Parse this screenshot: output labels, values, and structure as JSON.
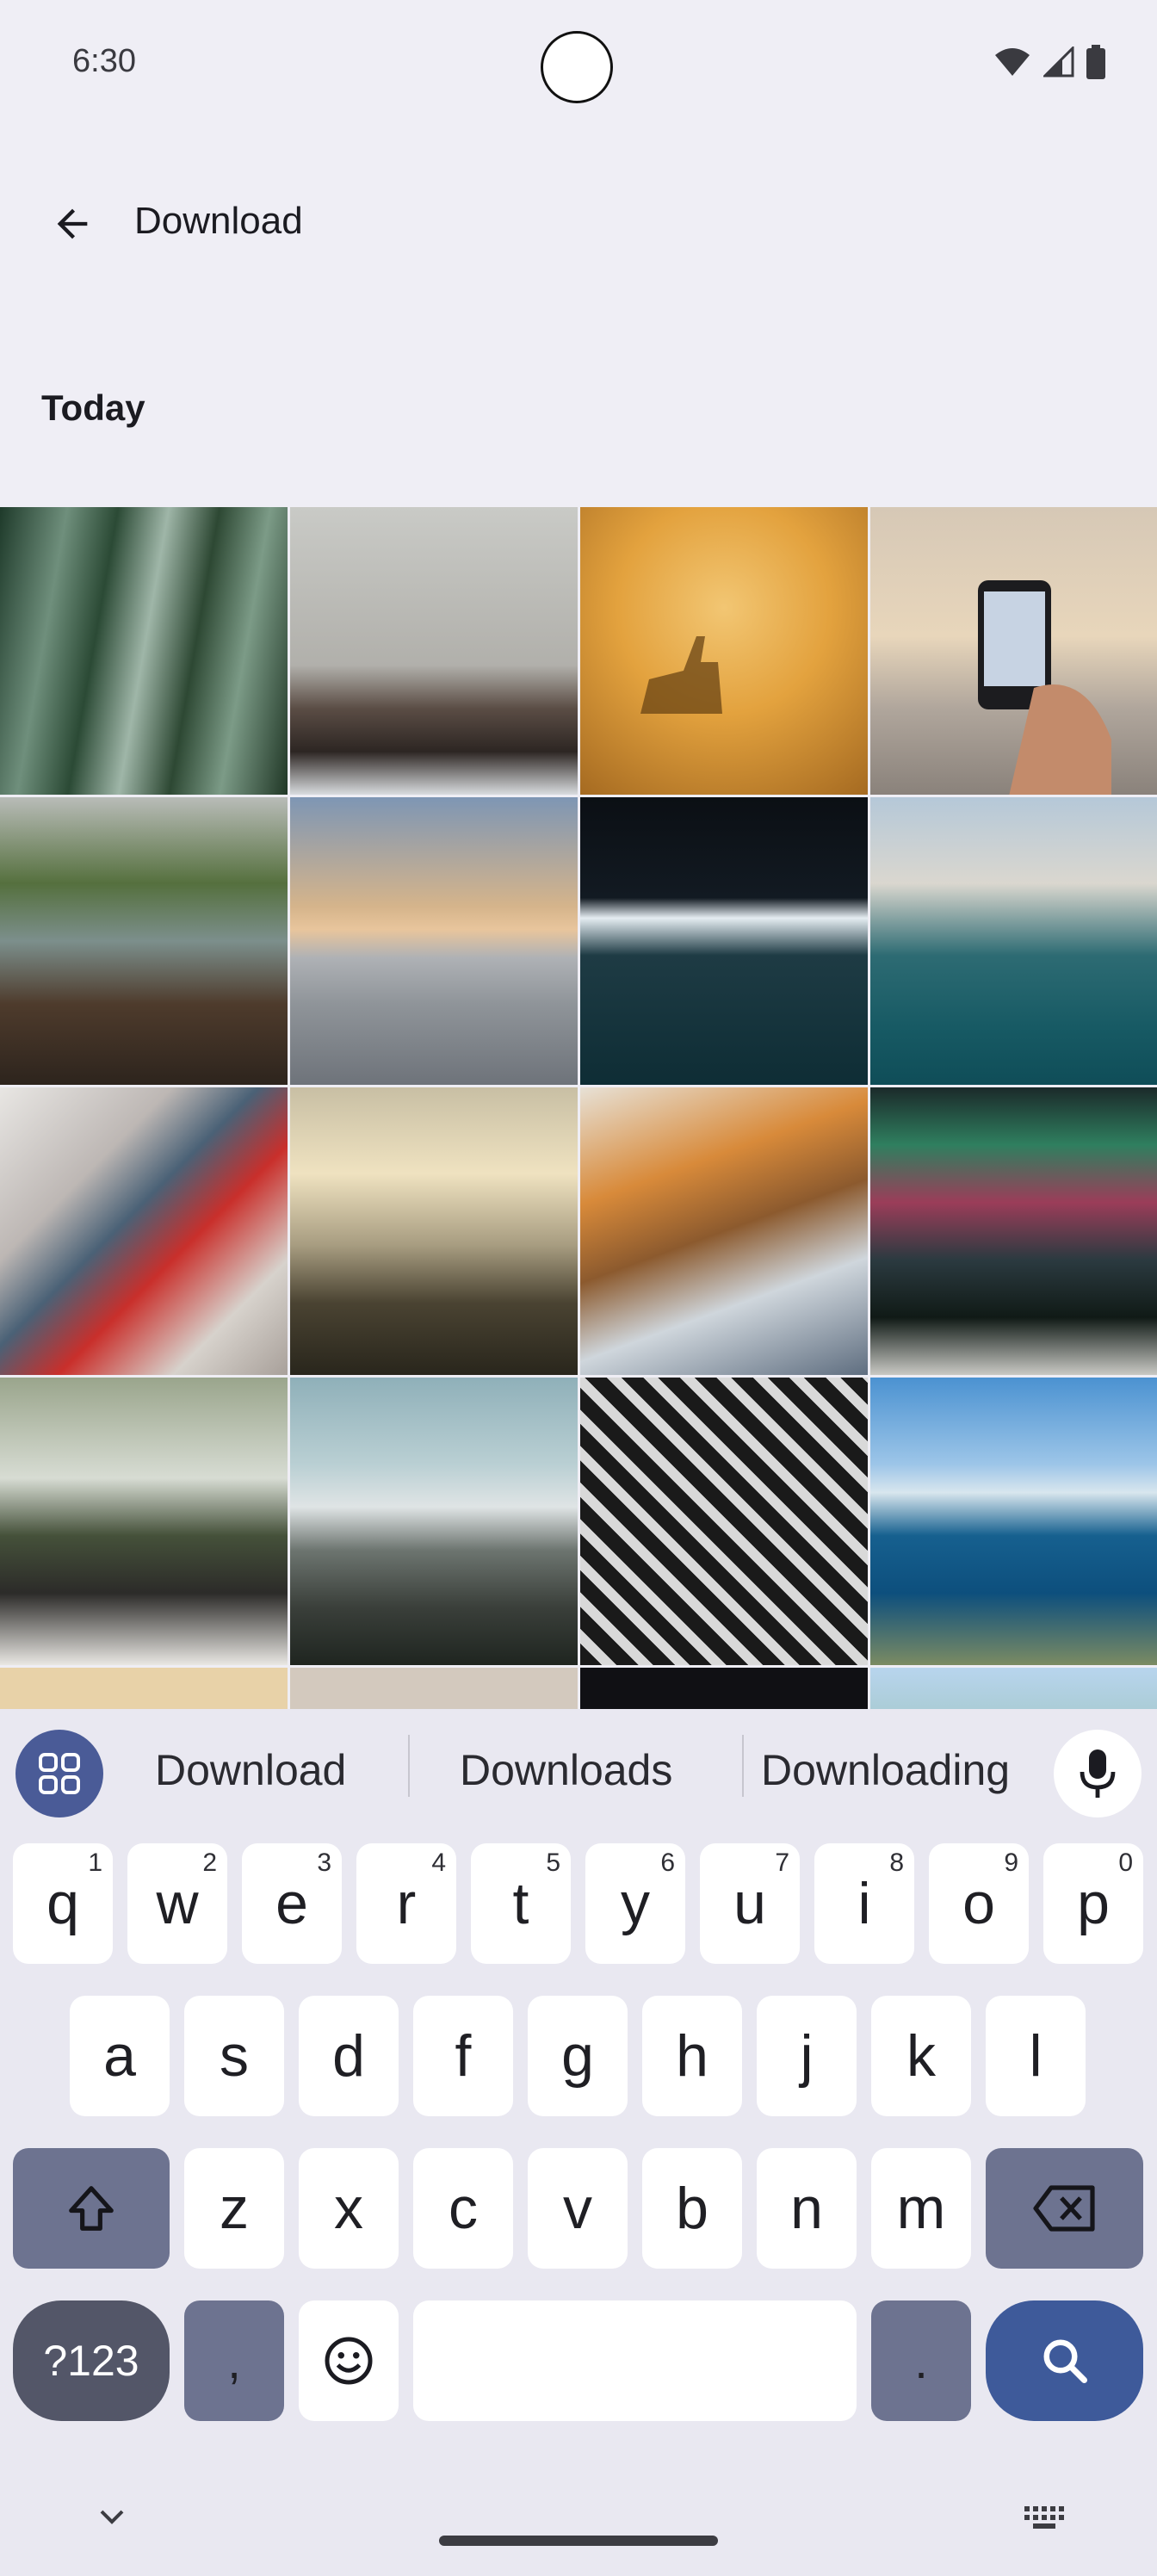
{
  "status_bar": {
    "time": "6:30"
  },
  "app_bar": {
    "title": "Download"
  },
  "section_label": "Today",
  "suggestions": [
    "Download",
    "Downloads",
    "Downloading"
  ],
  "keyboard": {
    "row1": [
      {
        "k": "q",
        "n": "1"
      },
      {
        "k": "w",
        "n": "2"
      },
      {
        "k": "e",
        "n": "3"
      },
      {
        "k": "r",
        "n": "4"
      },
      {
        "k": "t",
        "n": "5"
      },
      {
        "k": "y",
        "n": "6"
      },
      {
        "k": "u",
        "n": "7"
      },
      {
        "k": "i",
        "n": "8"
      },
      {
        "k": "o",
        "n": "9"
      },
      {
        "k": "p",
        "n": "0"
      }
    ],
    "row2": [
      "a",
      "s",
      "d",
      "f",
      "g",
      "h",
      "j",
      "k",
      "l"
    ],
    "row3": [
      "z",
      "x",
      "c",
      "v",
      "b",
      "n",
      "m"
    ],
    "symbols_label": "?123",
    "comma": ",",
    "period": "."
  },
  "colors": {
    "accent": "#4a5b97",
    "search_key": "#3e5a9a",
    "background": "#efeef5"
  },
  "photos": [
    "bamboo forest",
    "white building with car",
    "deer in fog",
    "phone photographing sunset",
    "river with rocks",
    "sea horizon sunset",
    "wave at night pool",
    "sea cliffs",
    "love locks",
    "misty hills",
    "sailing boat",
    "aurora over trees",
    "plant in vase on balcony",
    "snowy mountain",
    "steel tower",
    "coastline cliffs",
    "photo",
    "photo",
    "photo",
    "photo"
  ]
}
